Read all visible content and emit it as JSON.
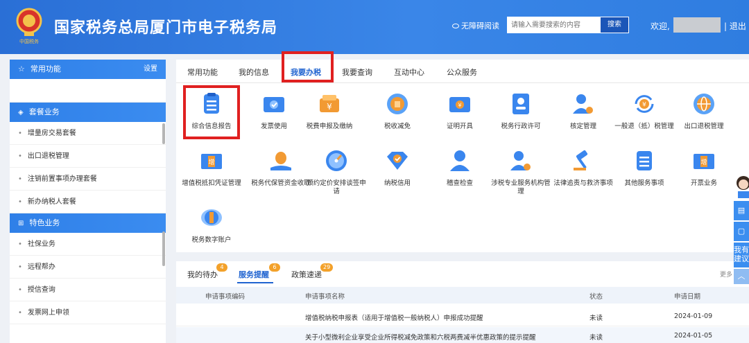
{
  "header": {
    "title": "国家税务总局厦门市电子税务局",
    "emblem_caption": "中国税务",
    "accessibility": "无障碍阅读",
    "search_placeholder": "请输入需要搜索的内容",
    "search_button": "搜索",
    "welcome": "欢迎,",
    "separator": "|",
    "logout": "退出"
  },
  "sidebar": {
    "title": "常用功能",
    "settings": "设置",
    "groups": [
      {
        "title": "套餐业务",
        "items": [
          "增量房交易套餐",
          "出口退税管理",
          "注销前置事项办理套餐",
          "新办纳税人套餐"
        ]
      },
      {
        "title": "特色业务",
        "items": [
          "社保业务",
          "远程帮办",
          "授信查询",
          "发票网上申领"
        ]
      }
    ]
  },
  "main": {
    "tabs": [
      "常用功能",
      "我的信息",
      "我要办税",
      "我要查询",
      "互动中心",
      "公众服务"
    ],
    "active_tab": "我要办税",
    "services": [
      {
        "label": "综合信息报告",
        "icon": "clipboard-icon"
      },
      {
        "label": "发票使用",
        "icon": "ticket-check-icon"
      },
      {
        "label": "税费申报及缴纳",
        "icon": "wallet-yen-icon"
      },
      {
        "label": "税收减免",
        "icon": "coin-reduce-icon"
      },
      {
        "label": "证明开具",
        "icon": "certificate-icon"
      },
      {
        "label": "税务行政许可",
        "icon": "id-badge-icon"
      },
      {
        "label": "核定管理",
        "icon": "user-gear-icon"
      },
      {
        "label": "一般退（抵）税管理",
        "icon": "refund-yen-icon"
      },
      {
        "label": "出口退税管理",
        "icon": "globe-icon"
      },
      {
        "label": "增值税抵扣凭证管理",
        "icon": "invoice-stack-icon"
      },
      {
        "label": "税务代保管资金收取",
        "icon": "money-bag-hand-icon"
      },
      {
        "label": "预约定价安排谈签申请",
        "icon": "compass-icon"
      },
      {
        "label": "纳税信用",
        "icon": "diamond-check-icon"
      },
      {
        "label": "稽查检查",
        "icon": "inspector-icon"
      },
      {
        "label": "涉税专业服务机构管理",
        "icon": "agency-user-icon"
      },
      {
        "label": "法律追责与救济事项",
        "icon": "gavel-icon"
      },
      {
        "label": "其他服务事项",
        "icon": "list-doc-icon"
      },
      {
        "label": "开票业务",
        "icon": "invoice-issue-icon"
      },
      {
        "label": "税务数字账户",
        "icon": "digital-account-icon"
      }
    ]
  },
  "notices": {
    "tabs": [
      {
        "label": "我的待办",
        "badge": "4"
      },
      {
        "label": "服务提醒",
        "badge": "6"
      },
      {
        "label": "政策速递",
        "badge": "29"
      }
    ],
    "more": "更多",
    "columns": [
      "申请事项编码",
      "申请事项名称",
      "状态",
      "申请日期"
    ],
    "rows": [
      {
        "code": "",
        "name": "增值税纳税申报表（适用于增值税一般纳税人）申报成功提醒",
        "status": "未读",
        "date": "2024-01-09"
      },
      {
        "code": "",
        "name": "关于小型微利企业享受企业所得税减免政策和六税两费减半优惠政策的提示提醒",
        "status": "未读",
        "date": "2024-01-05"
      }
    ]
  },
  "float": {
    "suggest": "我有建议",
    "up": "︿"
  },
  "colors": {
    "brand": "#2f7de0",
    "active": "#1f63d0",
    "highlight": "#e02020",
    "badge": "#f3a12a"
  }
}
